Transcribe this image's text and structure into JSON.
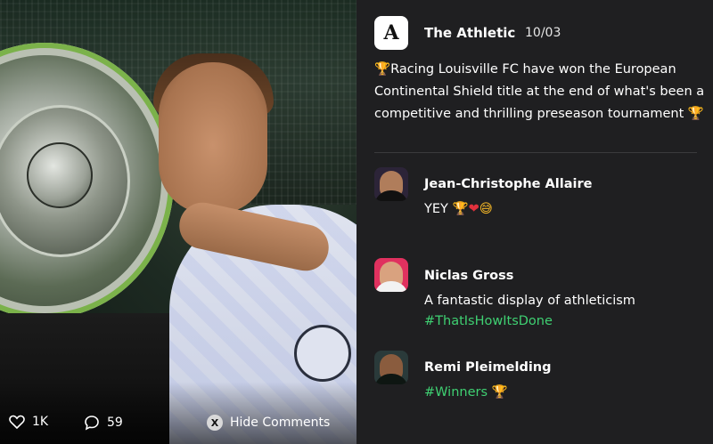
{
  "post": {
    "author": "The Athletic",
    "author_logo_letter": "A",
    "date": "10/03",
    "body_lead_emoji": "🏆",
    "body_text": "Racing Louisville FC have won the European Continental Shield title at the end of what's been a competitive and thrilling preseason tournament",
    "body_trail_emoji": "🏆"
  },
  "comments": [
    {
      "author": "Jean-Christophe Allaire",
      "text": "YEY",
      "emojis": [
        "🏆",
        "❤",
        "😅"
      ],
      "avatar_bg": "#2c2438"
    },
    {
      "author": "Niclas Gross",
      "text": "A fantastic display of athleticism",
      "hashtag": "#ThatIsHowItsDone",
      "avatar_bg": "#e0315f"
    },
    {
      "author": "Remi Pleimelding",
      "hashtag": "#Winners",
      "emojis": [
        "🏆"
      ],
      "avatar_bg": "#2a3a3a"
    }
  ],
  "footer": {
    "likes": "1K",
    "comments_count": "59",
    "controller_button": "X",
    "hide_comments_label": "Hide Comments"
  },
  "colors": {
    "panel_bg": "#1f1f21",
    "hashtag": "#3fd072",
    "divider": "#3a3a3d"
  },
  "icons": {
    "likes": "heart-icon",
    "comments": "comment-bubble-icon",
    "hide": "x-button-icon"
  }
}
